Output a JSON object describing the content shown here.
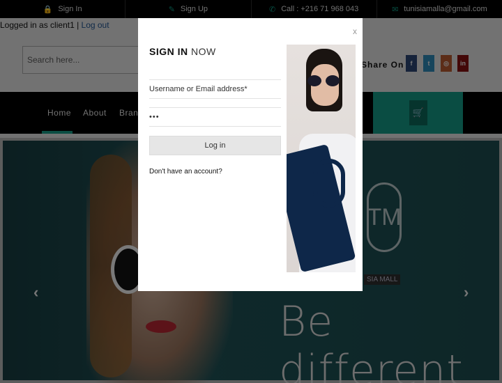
{
  "topbar": {
    "items": [
      {
        "icon": "lock-icon",
        "glyph": "🔒",
        "label": "Sign In"
      },
      {
        "icon": "edit-icon",
        "glyph": "✎",
        "label": "Sign Up"
      },
      {
        "icon": "phone-icon",
        "glyph": "✆",
        "label": "Call : +216 71 968 043"
      },
      {
        "icon": "envelope-icon",
        "glyph": "✉",
        "label": "tunisiamalla@gmail.com"
      }
    ]
  },
  "header": {
    "logged_in_text": "Logged in as client1 | ",
    "logout_label": "Log out",
    "search_placeholder": "Search here...",
    "share_label": "Share On :",
    "social": [
      {
        "name": "facebook",
        "glyph": "f"
      },
      {
        "name": "twitter",
        "glyph": "t"
      },
      {
        "name": "instagram",
        "glyph": "◎"
      },
      {
        "name": "linkedin",
        "glyph": "in"
      }
    ]
  },
  "nav": {
    "items": [
      "Home",
      "About",
      "Brand"
    ],
    "active": "Home",
    "cart_glyph": "🛒"
  },
  "hero": {
    "tagline": "Be different",
    "logo_text": "TM",
    "brand_tag": "SIA MALL",
    "prev_glyph": "‹",
    "next_glyph": "›"
  },
  "modal": {
    "close_label": "x",
    "title_bold": "SIGN IN",
    "title_rest": " NOW",
    "username_placeholder": "Username or Email address*",
    "password_value": "•••",
    "login_button": "Log in",
    "no_account_text": "Don't have an account?"
  },
  "colors": {
    "accent": "#138c7a",
    "topbar_bg": "#000000",
    "nav_bg": "#000000",
    "overlay": "rgba(0,0,0,0.45)"
  }
}
